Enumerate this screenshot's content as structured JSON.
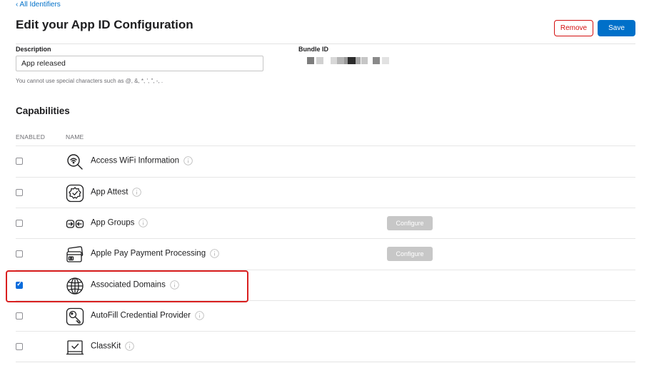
{
  "header": {
    "back_link": "‹ All Identifiers",
    "title": "Edit your App ID Configuration",
    "remove_label": "Remove",
    "save_label": "Save"
  },
  "form": {
    "description_label": "Description",
    "description_value": "App released",
    "description_hint": "You cannot use special characters such as @, &, *, ', \", -, .",
    "bundle_id_label": "Bundle ID"
  },
  "capabilities": {
    "title": "Capabilities",
    "col_enabled": "ENABLED",
    "col_name": "NAME",
    "configure_label": "Configure",
    "items": [
      {
        "name": "Access WiFi Information",
        "icon": "wifi-info-icon",
        "enabled": false,
        "configurable": false
      },
      {
        "name": "App Attest",
        "icon": "app-attest-icon",
        "enabled": false,
        "configurable": false
      },
      {
        "name": "App Groups",
        "icon": "app-groups-icon",
        "enabled": false,
        "configurable": true
      },
      {
        "name": "Apple Pay Payment Processing",
        "icon": "apple-pay-icon",
        "enabled": false,
        "configurable": true
      },
      {
        "name": "Associated Domains",
        "icon": "globe-icon",
        "enabled": true,
        "configurable": false
      },
      {
        "name": "AutoFill Credential Provider",
        "icon": "key-icon",
        "enabled": false,
        "configurable": false
      },
      {
        "name": "ClassKit",
        "icon": "classkit-icon",
        "enabled": false,
        "configurable": false
      }
    ]
  },
  "colors": {
    "accent": "#0070c9",
    "danger": "#d30f0f",
    "highlight": "#d91f1f",
    "checkbox_checked": "#0a6cdc",
    "configure_disabled": "#c7c7c7"
  }
}
